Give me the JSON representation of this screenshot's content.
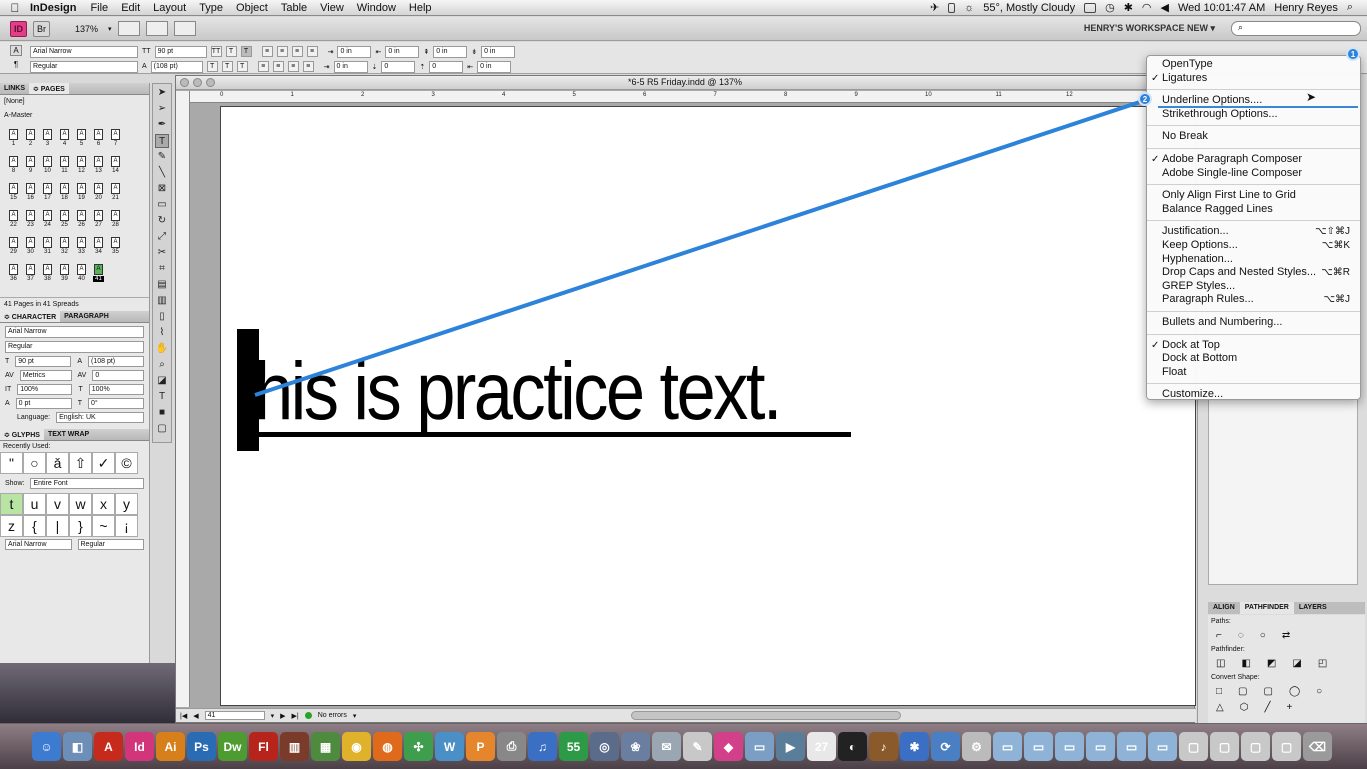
{
  "menubar": {
    "app": "InDesign",
    "menus": [
      "File",
      "Edit",
      "Layout",
      "Type",
      "Object",
      "Table",
      "View",
      "Window",
      "Help"
    ],
    "weather": "55°, Mostly Cloudy",
    "clock": "Wed 10:01:47 AM",
    "user": "Henry Reyes"
  },
  "appbar": {
    "id_label": "ID",
    "br_label": "Br",
    "zoom": "137%",
    "workspace": "HENRY'S WORKSPACE NEW ▾",
    "search_placeholder": "⌕"
  },
  "control": {
    "font": "Arial Narrow",
    "style": "Regular",
    "size": "90 pt",
    "leading": "(108 pt)",
    "indent_a": "0 in",
    "indent_b": "0 in",
    "indent_c": "0 in",
    "indent_d": "0 in",
    "space_a": "0 in",
    "space_b": "0",
    "space_c": "0",
    "space_d": "0 in"
  },
  "pages_panel": {
    "tabs": [
      "LINKS",
      "≎ PAGES"
    ],
    "masters": [
      "[None]",
      "A-Master"
    ],
    "pages": [
      "1",
      "2",
      "3",
      "4",
      "5",
      "6",
      "7",
      "8",
      "9",
      "10",
      "11",
      "12",
      "13",
      "14",
      "15",
      "16",
      "17",
      "18",
      "19",
      "20",
      "21",
      "22",
      "23",
      "24",
      "25",
      "26",
      "27",
      "28",
      "29",
      "30",
      "31",
      "32",
      "33",
      "34",
      "35",
      "36",
      "37",
      "38",
      "39",
      "40",
      "41"
    ],
    "status": "41 Pages in 41 Spreads"
  },
  "character_panel": {
    "tabs": [
      "≎ CHARACTER",
      "PARAGRAPH"
    ],
    "font": "Arial Narrow",
    "style": "Regular",
    "size": "90 pt",
    "leading": "(108 pt)",
    "kerning": "Metrics",
    "tracking": "0",
    "vscale": "100%",
    "hscale": "100%",
    "baseline": "0 pt",
    "skew": "0°",
    "language_label": "Language:",
    "language": "English: UK"
  },
  "glyphs_panel": {
    "tabs": [
      "≎ GLYPHS",
      "TEXT WRAP"
    ],
    "recent_label": "Recently Used:",
    "recent": [
      "\"",
      "○",
      "ǎ",
      "⇧",
      "✓",
      "©"
    ],
    "show_label": "Show:",
    "show": "Entire Font",
    "row2": [
      "t",
      "u",
      "v",
      "w",
      "x",
      "y"
    ],
    "row3": [
      "z",
      "{",
      "|",
      "}",
      "~",
      "¡"
    ],
    "font": "Arial Narrow",
    "style": "Regular"
  },
  "document": {
    "title": "*6-5 R5 Friday.indd @ 137%",
    "ruler_numbers": [
      "0",
      "1",
      "2",
      "3",
      "4",
      "5",
      "6",
      "7",
      "8",
      "9",
      "10",
      "11",
      "12"
    ],
    "text": "this is practice text.",
    "page_field": "41",
    "preflight": "No errors"
  },
  "context_menu": {
    "items": [
      {
        "label": "OpenType",
        "check": "",
        "shortcut": ""
      },
      {
        "label": "Ligatures",
        "check": "✓",
        "shortcut": ""
      },
      {
        "sep": true
      },
      {
        "label": "Underline Options....",
        "check": "",
        "shortcut": ""
      },
      {
        "label": "Strikethrough Options...",
        "check": "",
        "shortcut": ""
      },
      {
        "sep": true
      },
      {
        "label": "No Break",
        "check": "",
        "shortcut": ""
      },
      {
        "sep": true
      },
      {
        "label": "Adobe Paragraph Composer",
        "check": "✓",
        "shortcut": ""
      },
      {
        "label": "Adobe Single-line Composer",
        "check": "",
        "shortcut": ""
      },
      {
        "sep": true
      },
      {
        "label": "Only Align First Line to Grid",
        "check": "",
        "shortcut": ""
      },
      {
        "label": "Balance Ragged Lines",
        "check": "",
        "shortcut": ""
      },
      {
        "sep": true
      },
      {
        "label": "Justification...",
        "check": "",
        "shortcut": "⌥⇧⌘J"
      },
      {
        "label": "Keep Options...",
        "check": "",
        "shortcut": "⌥⌘K"
      },
      {
        "label": "Hyphenation...",
        "check": "",
        "shortcut": ""
      },
      {
        "label": "Drop Caps and Nested Styles...",
        "check": "",
        "shortcut": "⌥⌘R"
      },
      {
        "label": "GREP Styles...",
        "check": "",
        "shortcut": ""
      },
      {
        "label": "Paragraph Rules...",
        "check": "",
        "shortcut": "⌥⌘J"
      },
      {
        "sep": true
      },
      {
        "label": "Bullets and Numbering...",
        "check": "",
        "shortcut": ""
      },
      {
        "sep": true
      },
      {
        "label": "Dock at Top",
        "check": "✓",
        "shortcut": ""
      },
      {
        "label": "Dock at Bottom",
        "check": "",
        "shortcut": ""
      },
      {
        "label": "Float",
        "check": "",
        "shortcut": ""
      },
      {
        "sep": true
      },
      {
        "label": "Customize...",
        "check": "",
        "shortcut": ""
      }
    ]
  },
  "right_panel": {
    "tabs": [
      "ALIGN",
      "PATHFINDER",
      "LAYERS"
    ],
    "paths_label": "Paths:",
    "pathfinder_label": "Pathfinder:",
    "convert_label": "Convert Shape:"
  },
  "callouts": {
    "one": "1",
    "two": "2"
  },
  "dock": {
    "icons": [
      {
        "name": "finder",
        "label": "☺",
        "color": "#3d7bd1"
      },
      {
        "name": "preview",
        "label": "◧",
        "color": "#6d8fb7"
      },
      {
        "name": "acrobat",
        "label": "A",
        "color": "#c62a1c"
      },
      {
        "name": "indesign",
        "label": "Id",
        "color": "#d3357a"
      },
      {
        "name": "illustrator",
        "label": "Ai",
        "color": "#d67f1b"
      },
      {
        "name": "photoshop",
        "label": "Ps",
        "color": "#2a6cb3"
      },
      {
        "name": "dreamweaver",
        "label": "Dw",
        "color": "#4e9b32"
      },
      {
        "name": "flash",
        "label": "Fl",
        "color": "#b7241c"
      },
      {
        "name": "book",
        "label": "▥",
        "color": "#7a3b2b"
      },
      {
        "name": "calendar-app",
        "label": "▦",
        "color": "#4f8b3f"
      },
      {
        "name": "chrome",
        "label": "◉",
        "color": "#e0b12b"
      },
      {
        "name": "firefox",
        "label": "◍",
        "color": "#e06a1b"
      },
      {
        "name": "utility",
        "label": "✣",
        "color": "#3e9e4e"
      },
      {
        "name": "wordpress",
        "label": "W",
        "color": "#4b8fc7"
      },
      {
        "name": "presenter",
        "label": "P",
        "color": "#e5862d"
      },
      {
        "name": "scanner",
        "label": "⎙",
        "color": "#888888"
      },
      {
        "name": "itunes",
        "label": "♫",
        "color": "#3a6fc4"
      },
      {
        "name": "app-55",
        "label": "55",
        "color": "#2c9a46"
      },
      {
        "name": "safari",
        "label": "◎",
        "color": "#5b6c8a"
      },
      {
        "name": "iphoto",
        "label": "❀",
        "color": "#6a7fa0"
      },
      {
        "name": "mail",
        "label": "✉",
        "color": "#9aa7b3"
      },
      {
        "name": "textedit",
        "label": "✎",
        "color": "#c8c8c8"
      },
      {
        "name": "paint",
        "label": "◆",
        "color": "#d3408a"
      },
      {
        "name": "folder",
        "label": "▭",
        "color": "#7a9ec4"
      },
      {
        "name": "facetime",
        "label": "▶",
        "color": "#5a7e9a"
      },
      {
        "name": "ical",
        "label": "27",
        "color": "#e8e8e8"
      },
      {
        "name": "clock",
        "label": "◐",
        "color": "#222222"
      },
      {
        "name": "guitar",
        "label": "♪",
        "color": "#8a5a2a"
      },
      {
        "name": "bluetooth",
        "label": "✱",
        "color": "#3a6fc4"
      },
      {
        "name": "sync",
        "label": "⟳",
        "color": "#4a7fc4"
      },
      {
        "name": "gear",
        "label": "⚙",
        "color": "#bbbbbb"
      },
      {
        "name": "folder-1",
        "label": "▭",
        "color": "#8fb3d6"
      },
      {
        "name": "folder-2",
        "label": "▭",
        "color": "#8fb3d6"
      },
      {
        "name": "folder-3",
        "label": "▭",
        "color": "#8fb3d6"
      },
      {
        "name": "folder-4",
        "label": "▭",
        "color": "#8fb3d6"
      },
      {
        "name": "folder-5",
        "label": "▭",
        "color": "#8fb3d6"
      },
      {
        "name": "folder-6",
        "label": "▭",
        "color": "#8fb3d6"
      },
      {
        "name": "window-1",
        "label": "▢",
        "color": "#c8c8c8"
      },
      {
        "name": "window-2",
        "label": "▢",
        "color": "#c8c8c8"
      },
      {
        "name": "window-3",
        "label": "▢",
        "color": "#c8c8c8"
      },
      {
        "name": "window-4",
        "label": "▢",
        "color": "#c8c8c8"
      },
      {
        "name": "trash",
        "label": "⌫",
        "color": "#9a9a9a"
      }
    ]
  }
}
